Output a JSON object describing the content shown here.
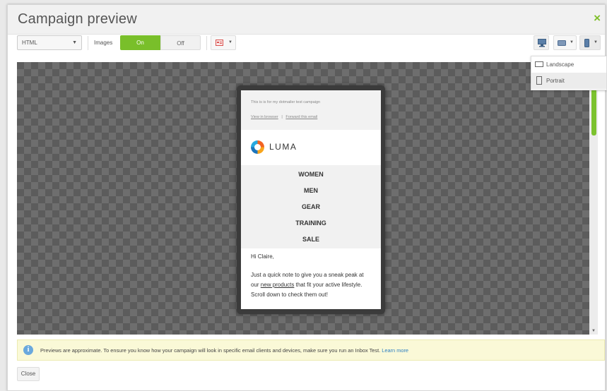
{
  "dialog": {
    "title": "Campaign preview",
    "close_x": "×"
  },
  "toolbar": {
    "format_select": "HTML",
    "images_label": "Images",
    "images_on": "On",
    "images_off": "Off"
  },
  "email": {
    "preheader_text": "This is is for my dotmailer test campaign",
    "view_in_browser": "View in browser",
    "link_separator": "|",
    "forward_email": "Forward this email",
    "brand": "LUMA",
    "nav": [
      "WOMEN",
      "MEN",
      "GEAR",
      "TRAINING",
      "SALE"
    ],
    "greeting": "Hi Claire,",
    "body_before_link": "Just a quick note to give you a sneak peak at our ",
    "body_link": "new products",
    "body_after_link": " that fit your active lifestyle. Scroll down to check them out!"
  },
  "orientation_menu": {
    "items": [
      "Landscape",
      "Portrait"
    ]
  },
  "info": {
    "text": "Previews are approximate. To ensure you know how your campaign will look in specific email clients and devices, make sure you run an Inbox Test.",
    "link": "Learn more"
  },
  "footer": {
    "close_label": "Close"
  },
  "colors": {
    "accent": "#79bf2a",
    "info_icon": "#6aa9dd",
    "link": "#2d7fc1"
  },
  "icons": {
    "desktop": "desktop-icon",
    "tablet": "tablet-icon",
    "mobile": "mobile-icon",
    "email_client": "email-client-icon"
  }
}
